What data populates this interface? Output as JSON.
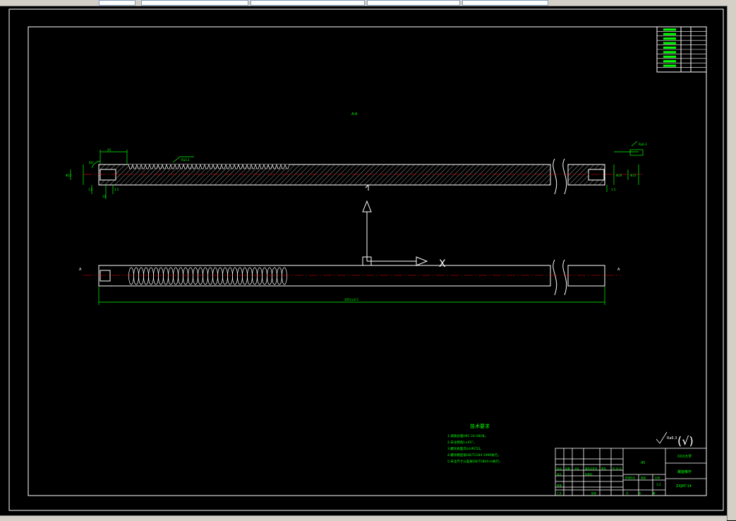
{
  "view": {
    "section_label": "A-A",
    "cut_mark_left": "A",
    "cut_mark_right": "A",
    "axis_x_label": "X",
    "axis_y_label": "Y"
  },
  "dimensions": {
    "overall_length": "2051±0.5",
    "thread_length": "M16-6H",
    "hole_depth": "25",
    "hole_dia": "Φ12",
    "roughness_top": "Ra3.2",
    "roughness_end": "Ra6.3",
    "chamfer": "1.5",
    "angle": "60°",
    "dim_small_a": "1.5",
    "dim_small_b": "1.5",
    "dim_small_c": "10",
    "dim_right_a": "Φ20",
    "dim_right_b": "Φ15",
    "dim_right_c": "1.5"
  },
  "tech_requirements": {
    "title": "技术要求",
    "items": [
      "1.调质处理HRC 24-28HB。",
      "2.未注倒角1×45°。",
      "3.螺纹表面淬火HRC52。",
      "4.螺纹精度按GB/T1184-1996执行。",
      "5.未注尺寸公差按GB/T1804-m执行。"
    ]
  },
  "roughness_note": {
    "value": "Ra6.3",
    "paren": "(√)"
  },
  "title_block": {
    "school": "XXX大学",
    "part_name": "螺旋推杆",
    "drawing_no": "ZXJKT-14",
    "material": "45",
    "scale": "1:2",
    "sheet_total": "共",
    "sheet_no": "张",
    "page": "第",
    "weight": "重量",
    "ratio": "比例",
    "stage": "阶段标记",
    "designer": "设计",
    "checker": "审核",
    "process": "工艺",
    "approve": "批准",
    "std": "标准化",
    "mark_row": [
      "标记",
      "处数",
      "分区",
      "更改文件号",
      "签名",
      "年.月.日"
    ]
  },
  "revision_table": {
    "rows": 10
  },
  "colors": {
    "outline": "#ffffff",
    "dimension": "#00ff00",
    "centerline": "#ff0000",
    "hatch": "#ffffff"
  }
}
